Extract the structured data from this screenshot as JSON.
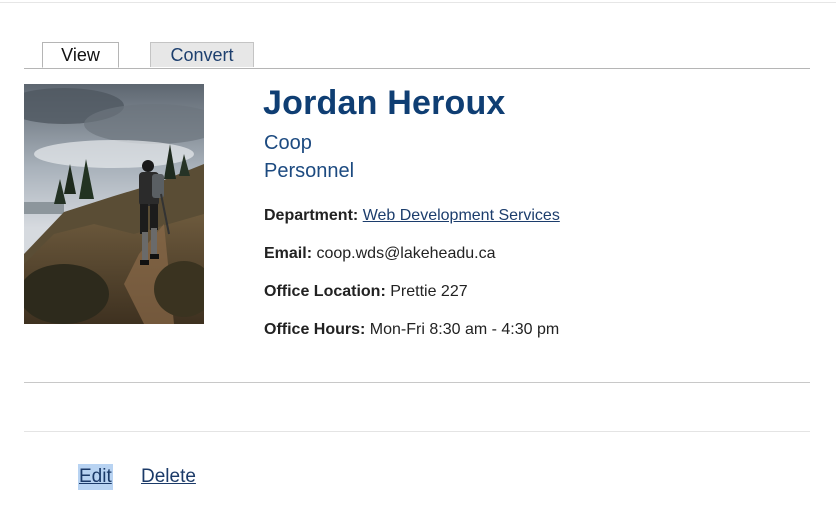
{
  "tabs": [
    {
      "label": "View",
      "active": true
    },
    {
      "label": "Convert",
      "active": false
    }
  ],
  "profile": {
    "name": "Jordan Heroux",
    "position": "Coop",
    "category": "Personnel",
    "photo_alt": "Person hiking on a rocky hillside trail"
  },
  "fields": {
    "department_label": "Department:",
    "department_value": "Web Development Services",
    "email_label": "Email:",
    "email_value": "coop.wds@lakeheadu.ca",
    "location_label": "Office Location:",
    "location_value": "Prettie 227",
    "hours_label": "Office Hours:",
    "hours_value": "Mon-Fri 8:30 am - 4:30 pm"
  },
  "actions": {
    "edit_label": "Edit",
    "delete_label": "Delete"
  },
  "colors": {
    "heading": "#0f3e73",
    "link": "#1c3d6c",
    "selection": "#b8d3f2"
  }
}
